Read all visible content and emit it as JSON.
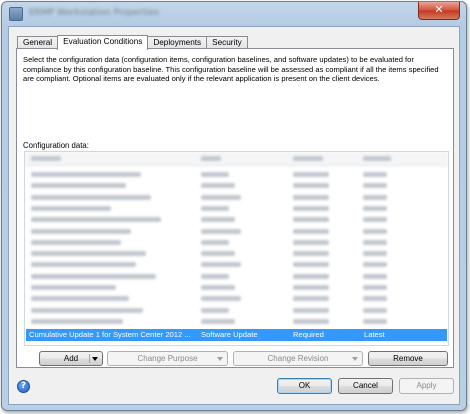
{
  "window": {
    "title": "ERMP Workstation Properties",
    "close_glyph": "✕"
  },
  "tabs": [
    {
      "label": "General",
      "active": false
    },
    {
      "label": "Evaluation Conditions",
      "active": true
    },
    {
      "label": "Deployments",
      "active": false
    },
    {
      "label": "Security",
      "active": false
    }
  ],
  "description": "Select the configuration data (configuration items, configuration baselines, and software updates) to be evaluated for compliance by this configuration baseline. This configuration baseline will be assessed as compliant if all the items specified are compliant. Optional items are evaluated only if the relevant application is present on  the client devices.",
  "config_label": "Configuration data:",
  "selected_row": {
    "name": "Cumulative Update 1 for System Center 2012 ...",
    "type": "Software Update",
    "purpose": "Required",
    "revision": "Latest"
  },
  "buttons": {
    "add": "Add",
    "change_purpose": "Change Purpose",
    "change_revision": "Change Revision",
    "remove": "Remove"
  },
  "dialog": {
    "help_glyph": "?",
    "ok": "OK",
    "cancel": "Cancel",
    "apply": "Apply"
  },
  "colors": {
    "selection": "#3399ff",
    "frame": "#b9cfe6",
    "close": "#c0391f"
  }
}
